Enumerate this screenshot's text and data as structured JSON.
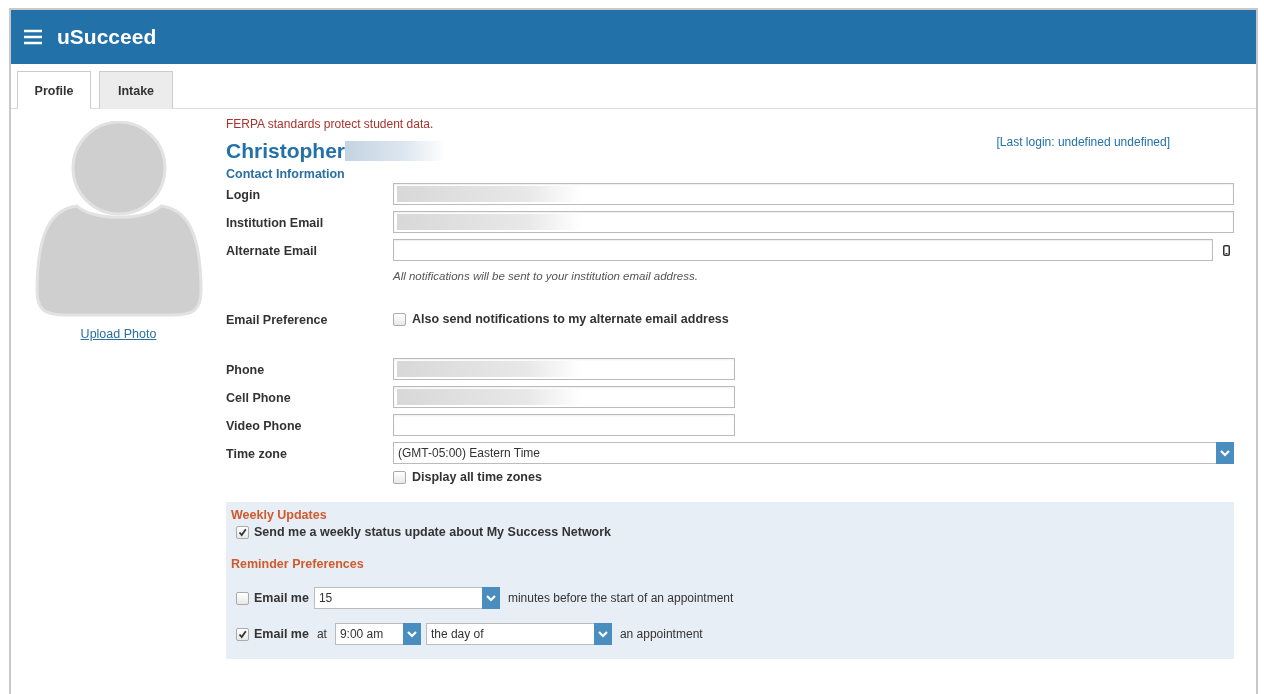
{
  "app": {
    "title": "uSucceed"
  },
  "tabs": [
    {
      "label": "Profile",
      "selected": true
    },
    {
      "label": "Intake",
      "selected": false
    }
  ],
  "photo": {
    "link": "Upload Photo"
  },
  "notice": "FERPA standards protect student data.",
  "name": {
    "first": "Christopher",
    "surname_redacted": true
  },
  "last_login": "[Last login: undefined undefined]",
  "section_title": "Contact Information",
  "rows": [
    {
      "kind": "text",
      "label": "Login",
      "redacted": true
    },
    {
      "kind": "text",
      "label": "Institution Email",
      "redacted": true
    },
    {
      "kind": "text_icon",
      "label": "Alternate Email",
      "redacted": false
    },
    {
      "kind": "note",
      "text": "All notifications will be sent to your institution email address."
    },
    {
      "kind": "checkbox",
      "label": "Email Preference",
      "option": "Also send notifications to my alternate email address",
      "checked": false
    },
    {
      "kind": "phone",
      "label": "Phone",
      "redacted": true
    },
    {
      "kind": "phone",
      "label": "Cell Phone",
      "redacted": true
    },
    {
      "kind": "phone",
      "label": "Video Phone",
      "redacted": false
    },
    {
      "kind": "select",
      "label": "Time zone",
      "value": "(GMT-05:00) Eastern Time"
    },
    {
      "kind": "checkbox",
      "option": "Display all time zones",
      "checked": false
    }
  ],
  "weekly_updates": {
    "title": "Weekly Updates",
    "option": "Send me a weekly status update about My Success Network",
    "checked": true
  },
  "reminders": {
    "title": "Reminder Preferences",
    "rows": [
      {
        "checked": false,
        "label": "Email me",
        "parts": [
          {
            "kind": "select",
            "value": "15"
          },
          {
            "kind": "text",
            "text": "minutes before the start of an appointment"
          }
        ]
      },
      {
        "checked": true,
        "label": "Email me",
        "parts": [
          {
            "kind": "text",
            "text": "at"
          },
          {
            "kind": "select",
            "value": "9:00 am"
          },
          {
            "kind": "select",
            "value": "the day of"
          },
          {
            "kind": "text",
            "text": "an appointment"
          }
        ]
      }
    ]
  }
}
